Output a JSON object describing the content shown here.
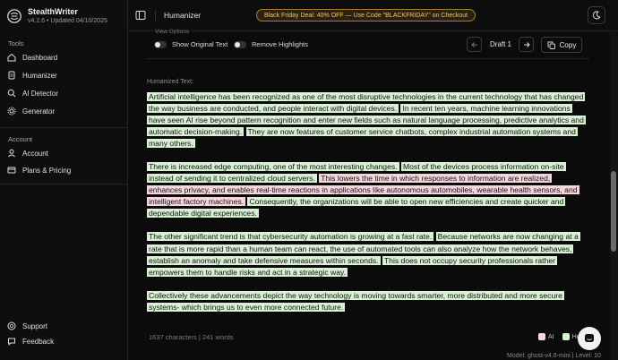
{
  "app": {
    "name": "StealthWriter",
    "version_info": "v4.2.6 • Updated 04/10/2025"
  },
  "sidebar": {
    "tools_heading": "Tools",
    "tools": [
      {
        "label": "Dashboard",
        "icon": "home-icon"
      },
      {
        "label": "Humanizer",
        "icon": "document-icon"
      },
      {
        "label": "AI Detector",
        "icon": "search-icon"
      },
      {
        "label": "Generator",
        "icon": "gear-icon"
      }
    ],
    "account_heading": "Account",
    "account": [
      {
        "label": "Account",
        "icon": "user-icon"
      },
      {
        "label": "Plans & Pricing",
        "icon": "card-icon"
      }
    ],
    "footer": [
      {
        "label": "Support",
        "icon": "help-icon"
      },
      {
        "label": "Feedback",
        "icon": "feedback-icon"
      }
    ]
  },
  "topbar": {
    "title": "Humanizer",
    "promo": "Black Friday Deal: 40% OFF — Use Code \"BLACKFRIDAY\" on Checkout"
  },
  "controls": {
    "cut_off_label": "View Options",
    "show_original": "Show Original Text",
    "remove_highlights": "Remove Highlights",
    "draft_label": "Draft 1",
    "copy_label": "Copy"
  },
  "output": {
    "label": "Humanized Text:",
    "paragraphs": [
      [
        {
          "type": "human",
          "text": "Artificial intelligence has been recognized as one of the most disruptive technologies in the current technology that has changed the way business are conducted, and people interact with digital devices."
        },
        {
          "type": "human",
          "text": "In recent ten years, machine learning innovations have seen AI rise beyond pattern recognition and enter new fields such as natural language processing, predictive analytics and automatic decision-making."
        },
        {
          "type": "human",
          "text": "They are now features of customer service chatbots, complex industrial automation systems and many others."
        }
      ],
      [
        {
          "type": "human",
          "text": "There is increased edge computing, one of the most interesting changes."
        },
        {
          "type": "human",
          "text": "Most of the devices process information on-site instead of sending it to centralized cloud servers."
        },
        {
          "type": "ai",
          "text": "This lowers the time in which responses to information are realized, enhances privacy, and enables real-time reactions in applications like autonomous automobiles, wearable health sensors, and intelligent factory machines."
        },
        {
          "type": "human",
          "text": "Consequently, the organizations will be able to open new efficiencies and create quicker and dependable digital experiences."
        }
      ],
      [
        {
          "type": "human",
          "text": "The other significant trend is that cybersecurity automation is growing at a fast rate."
        },
        {
          "type": "human",
          "text": "Because networks are now changing at a rate that is more rapid than a human team can react, the use of automated tools can also analyze how the network behaves, establish an anomaly and take defensive measures within seconds."
        },
        {
          "type": "human",
          "text": "This does not occupy security professionals rather empowers them to handle risks and act in a strategic way."
        }
      ],
      [
        {
          "type": "human",
          "text": "Collectively these advancements depict the way technology is moving towards smarter, more distributed and more secure systems- which brings us to even more connected future."
        }
      ]
    ]
  },
  "footer": {
    "stats": "1637 characters | 241 words",
    "legend_ai": "AI",
    "legend_human": "Hu",
    "model": "Model: ghost-v4.6-mini | Level: 10"
  },
  "colors": {
    "human_highlight": "#d8f0d3",
    "ai_highlight": "#f6d6dd",
    "promo_border": "#a4802e",
    "promo_text": "#f0c769"
  }
}
